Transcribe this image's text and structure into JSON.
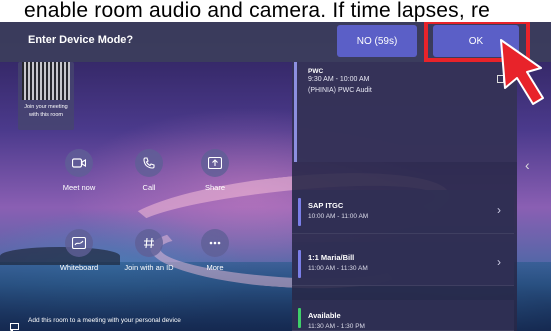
{
  "caption": "enable room audio and camera. If time lapses, re",
  "dialog": {
    "title": "Enter Device Mode?",
    "no_label": "NO (59s)",
    "ok_label": "OK"
  },
  "qr": {
    "label": "Join your meeting with this room"
  },
  "actions": [
    {
      "label": "Meet now",
      "icon": "video-camera-icon"
    },
    {
      "label": "Call",
      "icon": "phone-icon"
    },
    {
      "label": "Share",
      "icon": "share-screen-icon"
    },
    {
      "label": "Whiteboard",
      "icon": "whiteboard-icon"
    },
    {
      "label": "Join with an ID",
      "icon": "hash-icon"
    },
    {
      "label": "More",
      "icon": "more-icon"
    }
  ],
  "agenda": {
    "current": {
      "head": "PWC",
      "time": "9:30 AM - 10:00 AM",
      "title": "(PHINIA) PWC Audit"
    },
    "items": [
      {
        "name": "SAP ITGC",
        "time": "10:00 AM - 11:00 AM",
        "color": "#7b7fe8"
      },
      {
        "name": "1:1 Maria/Bill",
        "time": "11:00 AM - 11:30 AM",
        "color": "#7b7fe8"
      },
      {
        "name": "Available",
        "time": "11:30 AM - 1:30 PM",
        "color": "#3fcf6a"
      }
    ]
  },
  "footer": {
    "text": "Add this room to a meeting with your personal device"
  },
  "colors": {
    "button": "#5b5fc7",
    "highlight": "#e8232a"
  }
}
